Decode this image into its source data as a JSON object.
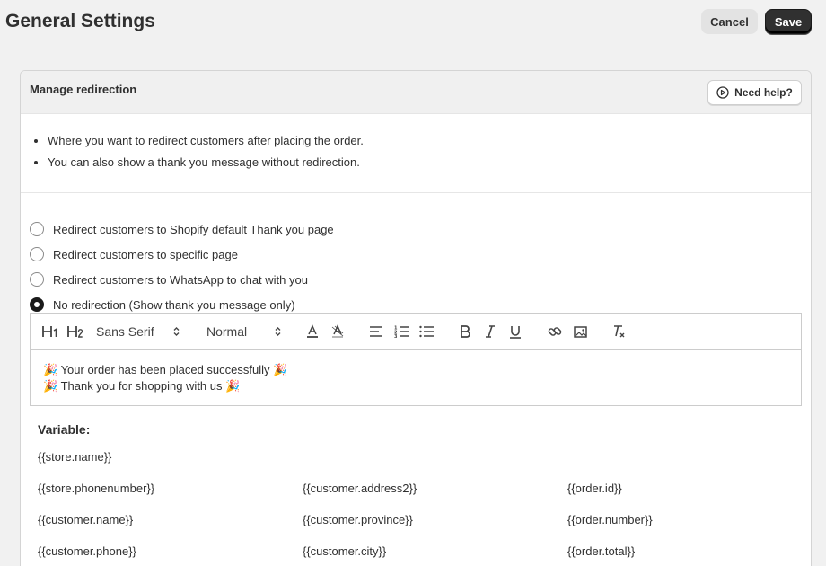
{
  "header": {
    "title": "General Settings",
    "cancel_label": "Cancel",
    "save_label": "Save"
  },
  "card": {
    "title": "Manage redirection",
    "help_label": "Need help?",
    "info": [
      "Where you want to redirect customers after placing the order.",
      "You can also show a thank you message without redirection."
    ],
    "options": [
      {
        "label": "Redirect customers to Shopify default Thank you page",
        "checked": false
      },
      {
        "label": "Redirect customers to specific page",
        "checked": false
      },
      {
        "label": "Redirect customers to WhatsApp to chat with you",
        "checked": false
      },
      {
        "label": "No redirection (Show thank you message only)",
        "checked": true
      }
    ]
  },
  "editor": {
    "font_value": "Sans Serif",
    "size_value": "Normal",
    "lines": [
      "🎉 Your order has been placed successfully 🎉",
      "🎉 Thank you for shopping with us 🎉"
    ]
  },
  "variables": {
    "title": "Variable:",
    "first": "{{store.name}}",
    "grid": [
      "{{store.phonenumber}}",
      "{{customer.address2}}",
      "{{order.id}}",
      "{{customer.name}}",
      "{{customer.province}}",
      "{{order.number}}",
      "{{customer.phone}}",
      "{{customer.city}}",
      "{{order.total}}"
    ]
  }
}
